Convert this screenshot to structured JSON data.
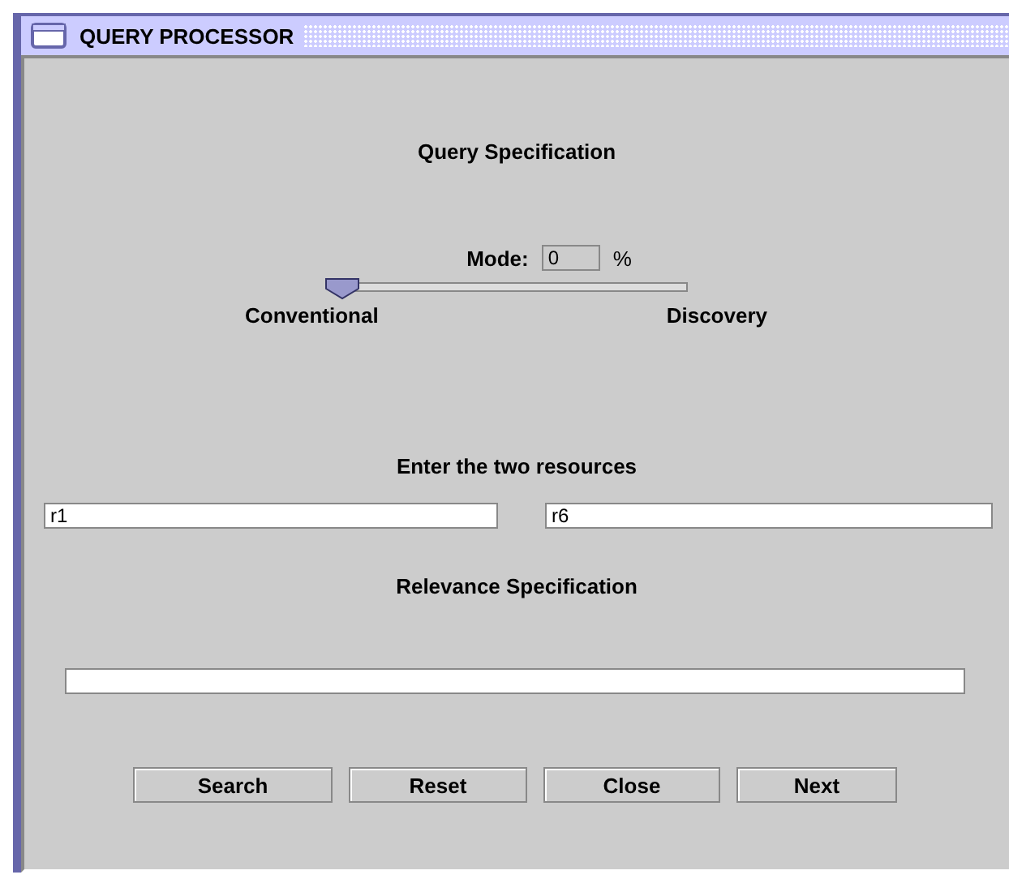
{
  "window": {
    "title": "QUERY PROCESSOR"
  },
  "query_heading": "Query Specification",
  "mode": {
    "label": "Mode:",
    "value": "0",
    "unit": "%",
    "level": 0,
    "min_label": "Conventional",
    "max_label": "Discovery"
  },
  "resources_heading": "Enter the two resources",
  "resources": [
    "r1",
    "r6"
  ],
  "relevance_heading": "Relevance Specification",
  "buttons": [
    "Search",
    "Reset",
    "Close",
    "Next"
  ]
}
